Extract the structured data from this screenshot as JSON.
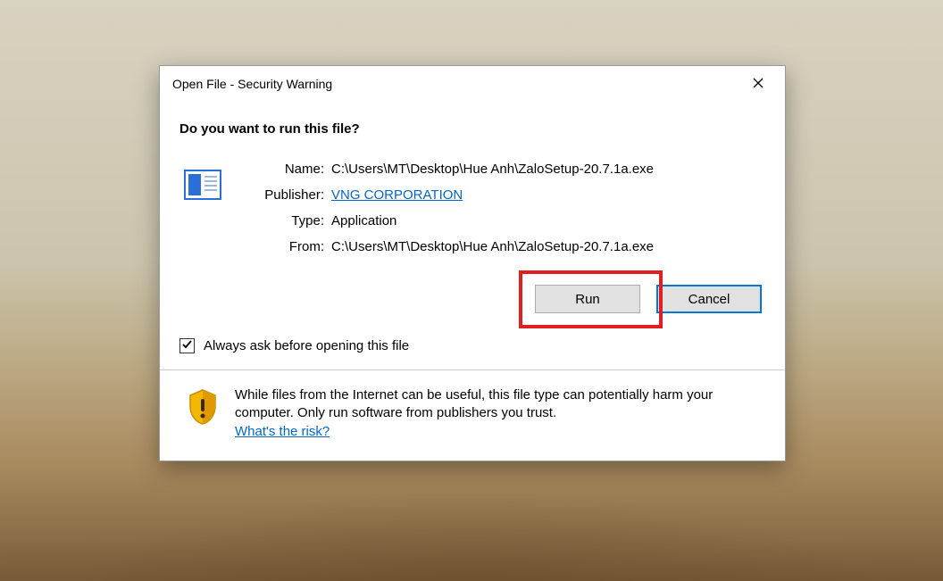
{
  "dialog": {
    "title": "Open File - Security Warning",
    "heading": "Do you want to run this file?",
    "fields": {
      "name_label": "Name:",
      "name_value": "C:\\Users\\MT\\Desktop\\Hue Anh\\ZaloSetup-20.7.1a.exe",
      "publisher_label": "Publisher:",
      "publisher_value": "VNG CORPORATION",
      "type_label": "Type:",
      "type_value": "Application",
      "from_label": "From:",
      "from_value": "C:\\Users\\MT\\Desktop\\Hue Anh\\ZaloSetup-20.7.1a.exe"
    },
    "buttons": {
      "run": "Run",
      "cancel": "Cancel"
    },
    "checkbox": {
      "label": "Always ask before opening this file",
      "checked": true
    },
    "footer": {
      "warning_text": "While files from the Internet can be useful, this file type can potentially harm your computer. Only run software from publishers you trust.",
      "risk_link": "What's the risk?"
    }
  },
  "annotation": {
    "highlighted_button": "run"
  }
}
